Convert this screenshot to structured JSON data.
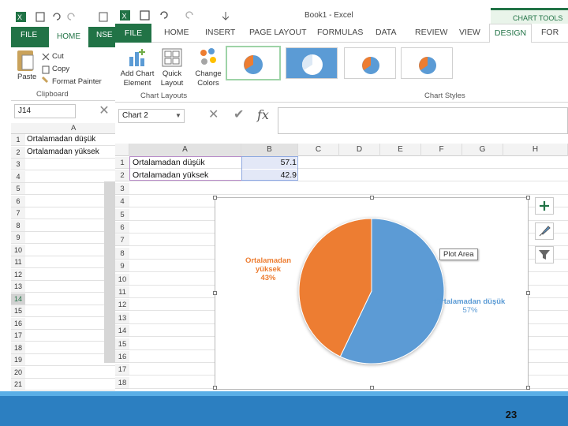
{
  "back_window": {
    "tabs": [
      "FILE",
      "HOME",
      "NSE"
    ],
    "ribbon": {
      "paste": "Paste",
      "cut": "Cut",
      "copy": "Copy",
      "format_painter": "Format Painter",
      "clipboard": "Clipboard"
    },
    "name_box": "J14",
    "rows": [
      {
        "num": "1",
        "a": "Ortalamadan düşük"
      },
      {
        "num": "2",
        "a": "Ortalamadan yüksek"
      },
      {
        "num": "3",
        "a": ""
      },
      {
        "num": "4",
        "a": ""
      },
      {
        "num": "5",
        "a": ""
      },
      {
        "num": "6",
        "a": ""
      },
      {
        "num": "7",
        "a": ""
      },
      {
        "num": "8",
        "a": ""
      },
      {
        "num": "9",
        "a": ""
      },
      {
        "num": "10",
        "a": ""
      },
      {
        "num": "11",
        "a": ""
      },
      {
        "num": "12",
        "a": ""
      },
      {
        "num": "13",
        "a": ""
      },
      {
        "num": "14",
        "a": ""
      },
      {
        "num": "15",
        "a": ""
      },
      {
        "num": "16",
        "a": ""
      },
      {
        "num": "17",
        "a": ""
      },
      {
        "num": "18",
        "a": ""
      },
      {
        "num": "19",
        "a": ""
      },
      {
        "num": "20",
        "a": ""
      },
      {
        "num": "21",
        "a": ""
      }
    ],
    "col_header": "A"
  },
  "main_window": {
    "title": "Book1 - Excel",
    "chart_tools": "CHART TOOLS",
    "tabs": [
      "FILE",
      "HOME",
      "INSERT",
      "PAGE LAYOUT",
      "FORMULAS",
      "DATA",
      "REVIEW",
      "VIEW",
      "DESIGN",
      "FOR"
    ],
    "ribbon": {
      "add_chart_element": "Add Chart Element",
      "quick_layout": "Quick Layout",
      "change_colors": "Change Colors",
      "chart_layouts": "Chart Layouts",
      "chart_styles": "Chart Styles"
    },
    "name_box": "Chart 2",
    "fx": "fx",
    "columns": [
      "A",
      "B",
      "C",
      "D",
      "E",
      "F",
      "G",
      "H"
    ],
    "rows": [
      {
        "num": "1",
        "a": "Ortalamadan düşük",
        "b": "57.1"
      },
      {
        "num": "2",
        "a": "Ortalamadan yüksek",
        "b": "42.9"
      },
      {
        "num": "3"
      },
      {
        "num": "4"
      },
      {
        "num": "5"
      },
      {
        "num": "6"
      },
      {
        "num": "7"
      },
      {
        "num": "8"
      },
      {
        "num": "9"
      },
      {
        "num": "10"
      },
      {
        "num": "11"
      },
      {
        "num": "12"
      },
      {
        "num": "13"
      },
      {
        "num": "14"
      },
      {
        "num": "15"
      },
      {
        "num": "16"
      },
      {
        "num": "17"
      },
      {
        "num": "18"
      }
    ],
    "tooltip": "Plot Area"
  },
  "colors": {
    "excel_green": "#217346",
    "pie_blue": "#5b9bd5",
    "pie_orange": "#ed7d31",
    "band_blue": "#2c7fc1"
  },
  "chart_data": {
    "type": "pie",
    "categories": [
      "Ortalamadan düşük",
      "Ortalamadan yüksek"
    ],
    "values": [
      57.1,
      42.9
    ],
    "labels": [
      {
        "name": "Ortalamadan düşük",
        "percent": "57%"
      },
      {
        "name": "Ortalamadan yüksek",
        "percent": "43%"
      }
    ],
    "colors": [
      "#5b9bd5",
      "#ed7d31"
    ],
    "title": ""
  },
  "footer": {
    "page_number": "23"
  }
}
